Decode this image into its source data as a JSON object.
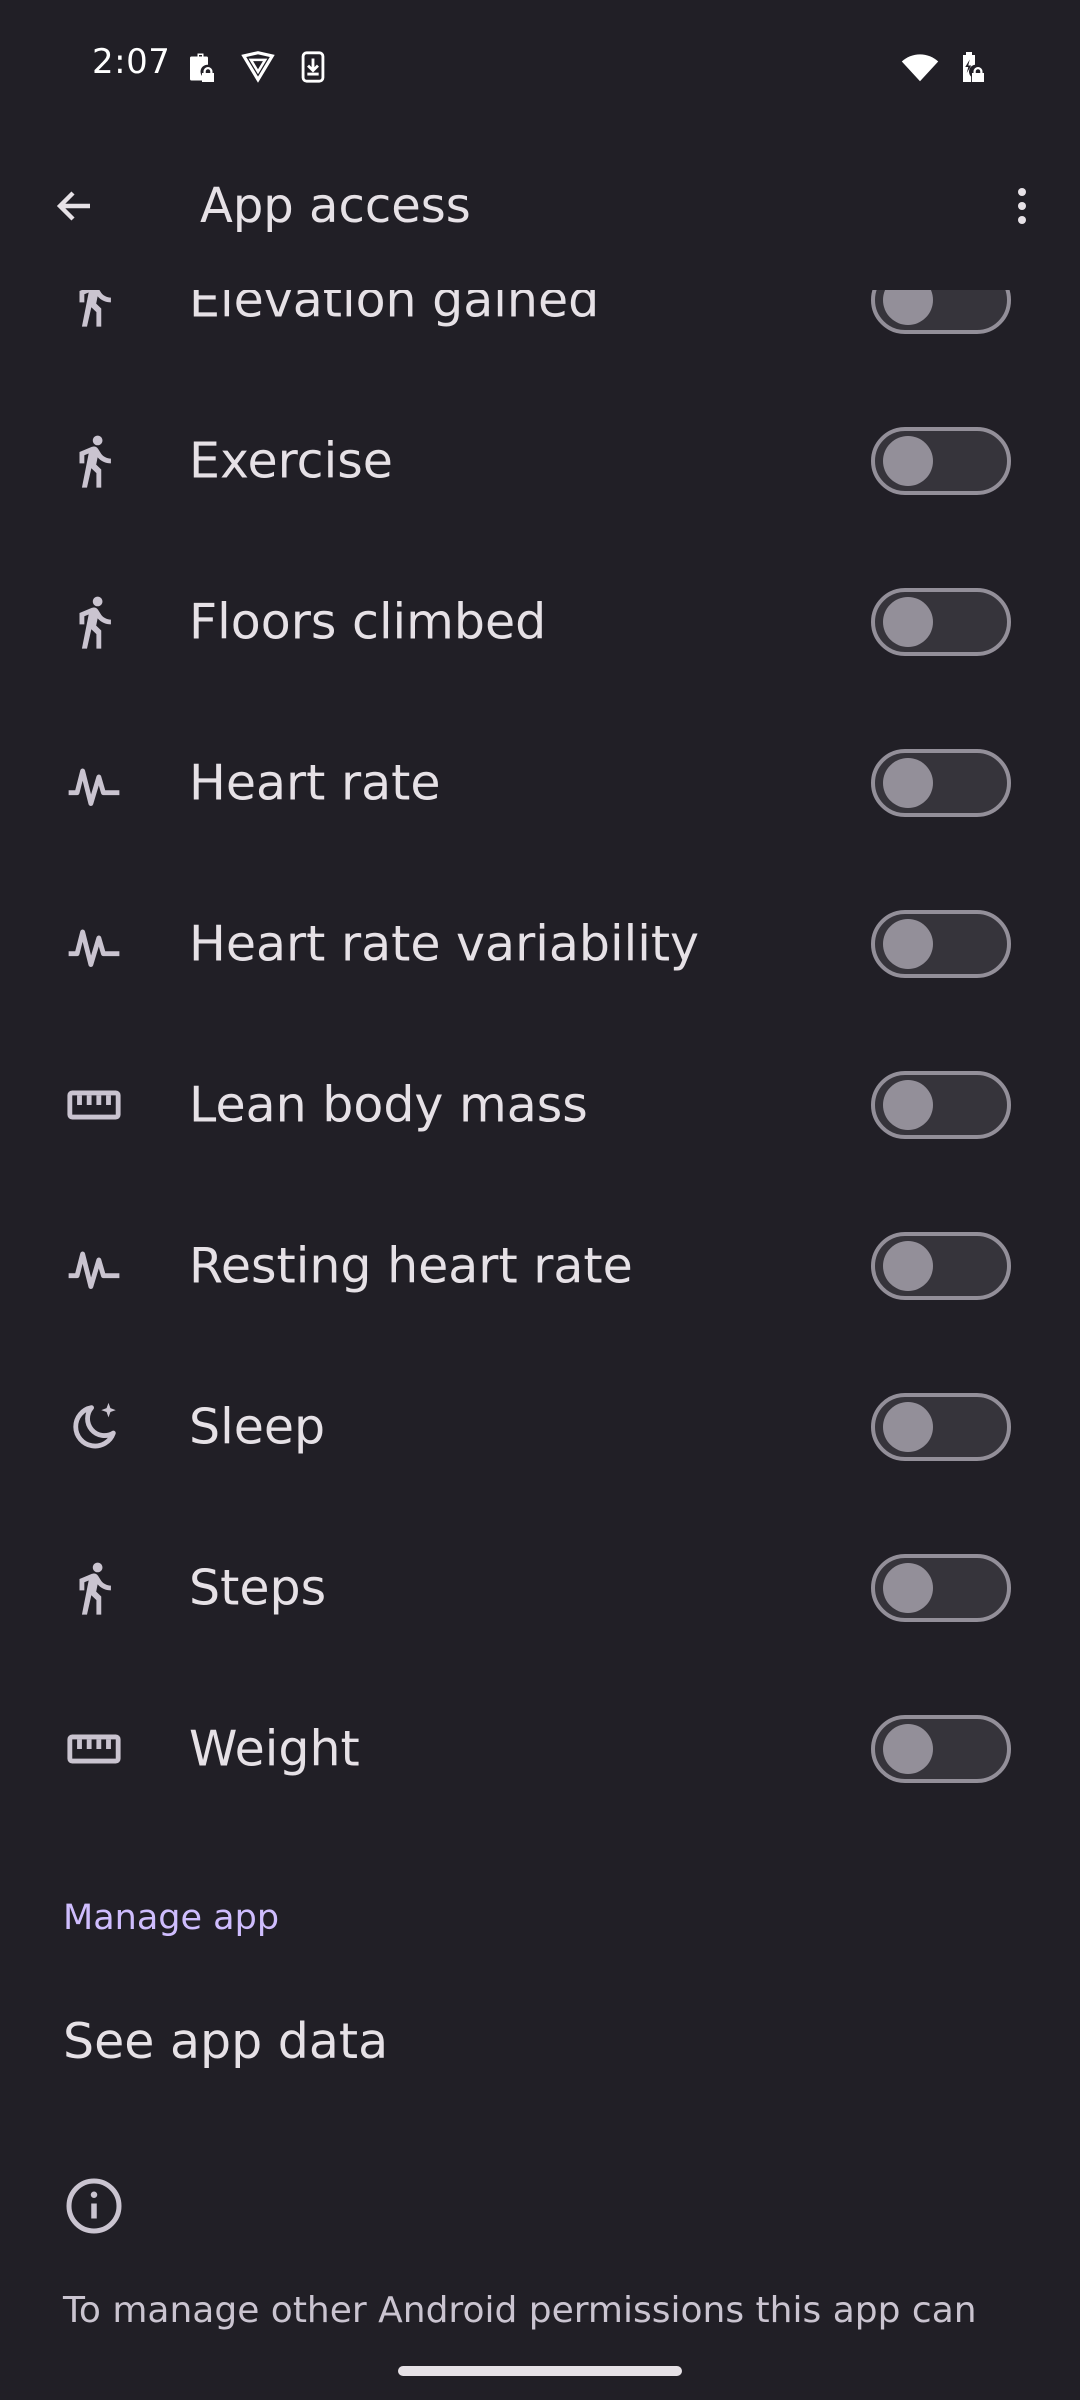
{
  "status_bar": {
    "time": "2:07",
    "icons": [
      "work-profile-icon",
      "vpn-shield-icon",
      "download-icon",
      "wifi-icon",
      "battery-charging-icon"
    ]
  },
  "header": {
    "title": "App access",
    "back_icon": "arrow-back-icon",
    "more_icon": "more-vert-icon"
  },
  "permissions": [
    {
      "label": "Elevation gained",
      "icon": "directions-run-icon",
      "enabled": false
    },
    {
      "label": "Exercise",
      "icon": "directions-run-icon",
      "enabled": false
    },
    {
      "label": "Floors climbed",
      "icon": "directions-run-icon",
      "enabled": false
    },
    {
      "label": "Heart rate",
      "icon": "monitor-heart-icon",
      "enabled": false
    },
    {
      "label": "Heart rate variability",
      "icon": "monitor-heart-icon",
      "enabled": false
    },
    {
      "label": "Lean body mass",
      "icon": "straighten-ruler-icon",
      "enabled": false
    },
    {
      "label": "Resting heart rate",
      "icon": "monitor-heart-icon",
      "enabled": false
    },
    {
      "label": "Sleep",
      "icon": "bedtime-icon",
      "enabled": false
    },
    {
      "label": "Steps",
      "icon": "directions-run-icon",
      "enabled": false
    },
    {
      "label": "Weight",
      "icon": "straighten-ruler-icon",
      "enabled": false
    }
  ],
  "manage_app": {
    "section_title": "Manage app",
    "see_app_data": "See app data"
  },
  "footer": {
    "info_icon": "info-icon",
    "text": "To manage other Android permissions this app can"
  },
  "colors": {
    "background": "#211f26",
    "accent": "#cfbdfe",
    "text_primary": "#e6e1e6",
    "toggle_outline": "#938f99"
  }
}
